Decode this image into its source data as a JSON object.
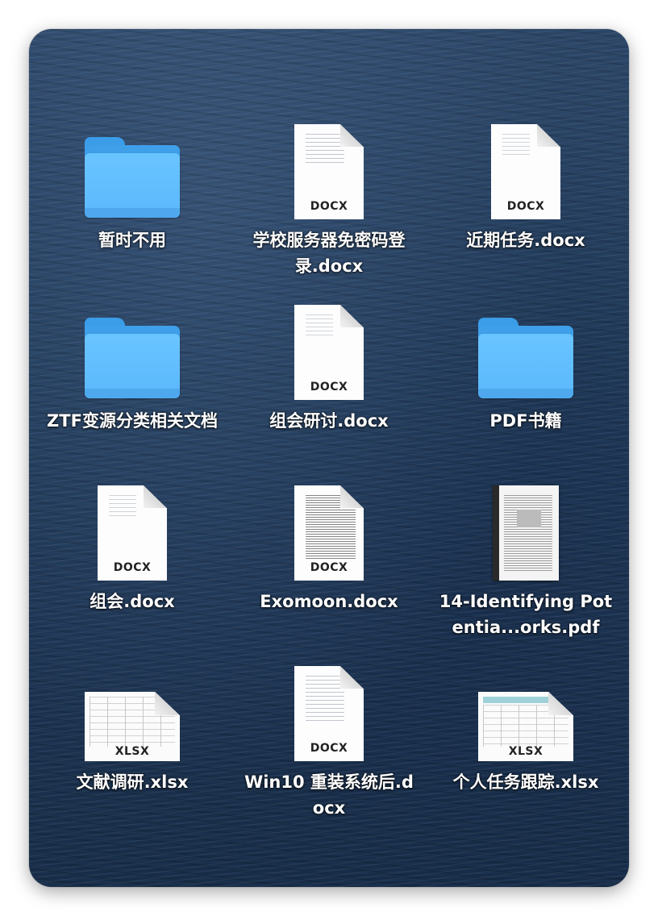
{
  "items": [
    {
      "label": "暂时不用",
      "kind": "folder"
    },
    {
      "label": "学校服务器免密码登录.docx",
      "kind": "docx",
      "badge": "DOCX"
    },
    {
      "label": "近期任务.docx",
      "kind": "docx",
      "badge": "DOCX"
    },
    {
      "label": "ZTF变源分类相关文档",
      "kind": "folder"
    },
    {
      "label": "组会研讨.docx",
      "kind": "docx",
      "badge": "DOCX"
    },
    {
      "label": "PDF书籍",
      "kind": "folder"
    },
    {
      "label": "组会.docx",
      "kind": "docx",
      "badge": "DOCX"
    },
    {
      "label": "Exomoon.docx",
      "kind": "docx",
      "badge": "DOCX"
    },
    {
      "label": "14-Identifying Potentia...orks.pdf",
      "kind": "pdf"
    },
    {
      "label": "文献调研.xlsx",
      "kind": "xlsx",
      "badge": "XLSX"
    },
    {
      "label": "Win10 重装系统后.docx",
      "kind": "docx",
      "badge": "DOCX"
    },
    {
      "label": "个人任务跟踪.xlsx",
      "kind": "xlsx",
      "badge": "XLSX"
    }
  ],
  "colors": {
    "folder_blue": "#5bb8fb",
    "wallpaper": "#203a59"
  }
}
